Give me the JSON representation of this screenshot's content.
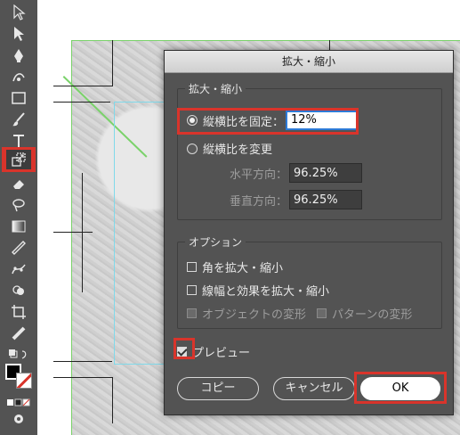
{
  "toolbar": {
    "tools": [
      "selection-tool",
      "direct-selection-tool",
      "pen-tool",
      "curvature-tool",
      "rectangle-tool",
      "paintbrush-tool",
      "type-tool",
      "scale-tool",
      "eraser-tool",
      "lasso-tool",
      "gradient-tool",
      "eyedropper-tool",
      "puppet-warp-tool",
      "shape-builder-tool",
      "crop-tool",
      "measure-tool"
    ],
    "active_tool": "scale-tool"
  },
  "dialog": {
    "title": "拡大・縮小",
    "scale_group": {
      "title": "拡大・縮小",
      "uniform_label": "縦横比を固定：",
      "uniform_value": "12%",
      "nonuniform_label": "縦横比を変更",
      "horizontal_label": "水平方向：",
      "horizontal_value": "96.25%",
      "vertical_label": "垂直方向：",
      "vertical_value": "96.25%"
    },
    "options_group": {
      "title": "オプション",
      "scale_corners": "角を拡大・縮小",
      "scale_strokes": "線幅と効果を拡大・縮小",
      "transform_objects": "オブジェクトの変形",
      "transform_patterns": "パターンの変形"
    },
    "preview_label": "プレビュー",
    "buttons": {
      "copy": "コピー",
      "cancel": "キャンセル",
      "ok": "OK"
    }
  },
  "colors": {
    "accent_red": "#d9342b",
    "panel": "#535353",
    "focus_blue": "#2d7ad6"
  }
}
